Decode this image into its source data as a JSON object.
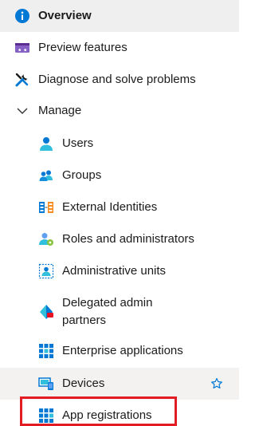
{
  "nav": {
    "overview": "Overview",
    "preview_features": "Preview features",
    "diagnose": "Diagnose and solve problems",
    "manage": "Manage",
    "users": "Users",
    "groups": "Groups",
    "external_identities": "External Identities",
    "roles": "Roles and administrators",
    "admin_units": "Administrative units",
    "delegated_line1": "Delegated admin",
    "delegated_line2": "partners",
    "enterprise_apps": "Enterprise applications",
    "devices": "Devices",
    "app_registrations": "App registrations"
  },
  "colors": {
    "highlight": "#e31b23",
    "accent": "#0078d4",
    "selected_bg": "#efefef"
  }
}
